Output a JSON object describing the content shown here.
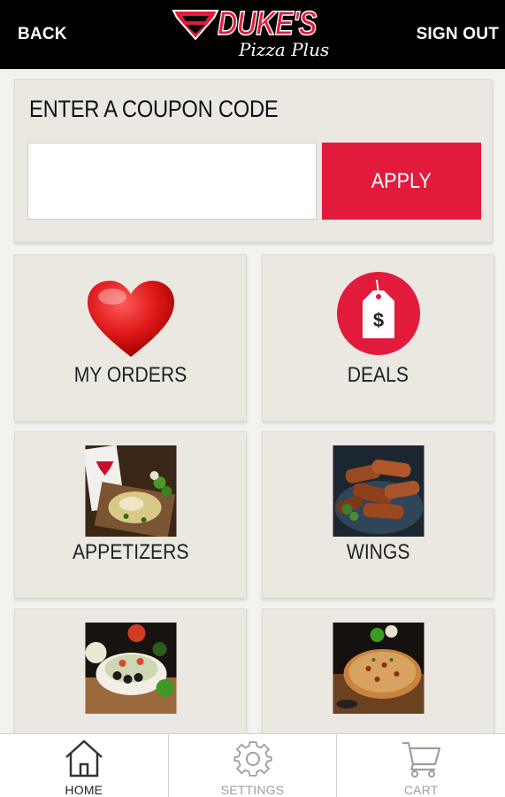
{
  "header": {
    "back_label": "BACK",
    "signout_label": "SIGN OUT",
    "logo_name": "DUKE'S",
    "logo_sub": "Pizza Plus"
  },
  "coupon": {
    "title": "ENTER A COUPON CODE",
    "input_value": "",
    "apply_label": "APPLY"
  },
  "tiles": [
    {
      "label": "MY ORDERS",
      "icon": "heart-icon"
    },
    {
      "label": "DEALS",
      "icon": "price-tag-icon"
    },
    {
      "label": "APPETIZERS",
      "icon": "appetizers-image"
    },
    {
      "label": "WINGS",
      "icon": "wings-image"
    },
    {
      "label": "",
      "icon": "salad-image"
    },
    {
      "label": "",
      "icon": "pizza-image"
    }
  ],
  "tabs": [
    {
      "label": "HOME",
      "icon": "home-icon",
      "active": true
    },
    {
      "label": "SETTINGS",
      "icon": "gear-icon",
      "active": false
    },
    {
      "label": "CART",
      "icon": "cart-icon",
      "active": false
    }
  ],
  "colors": {
    "brand_red": "#e21b3c",
    "header_bg": "#000000",
    "panel_bg": "#ebe8e2"
  }
}
